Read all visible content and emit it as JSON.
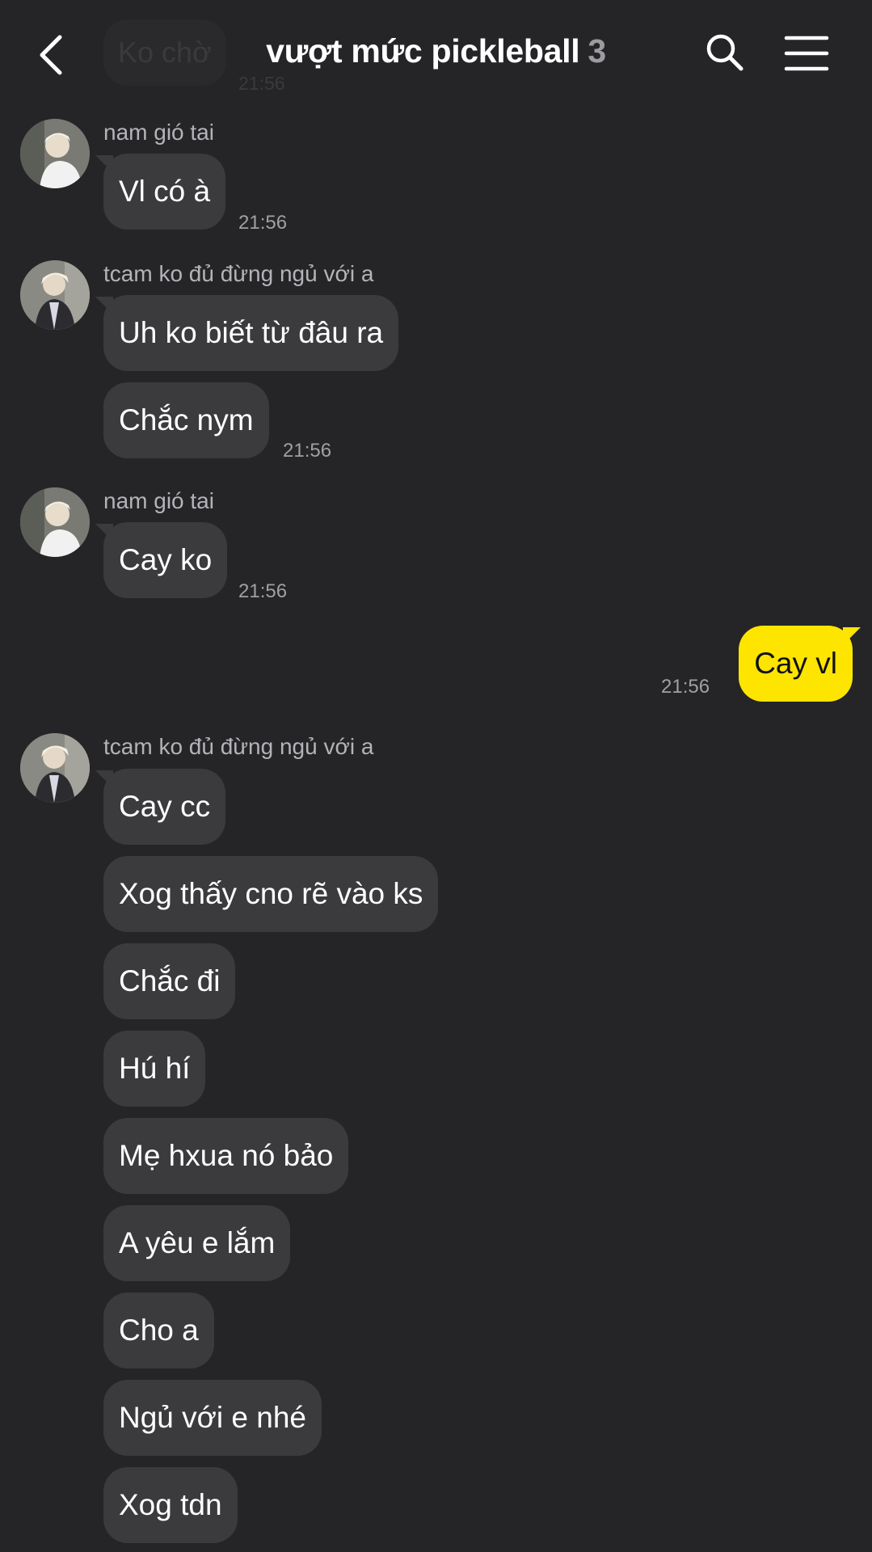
{
  "header": {
    "title": "vượt mức pickleball",
    "member_count": "3"
  },
  "ghost": {
    "message": "Ko chờ",
    "time": "21:56"
  },
  "messages": [
    {
      "sender": "nam gió tai",
      "text": "Vl có à",
      "time": "21:56"
    },
    {
      "sender": "tcam ko đủ đừng ngủ với a",
      "text": "Uh ko biết từ đâu ra"
    },
    {
      "text": "Chắc nym",
      "time": "21:56"
    },
    {
      "sender": "nam gió tai",
      "text": "Cay ko",
      "time": "21:56"
    },
    {
      "mine": true,
      "text": "Cay vl",
      "time": "21:56"
    },
    {
      "sender": "tcam ko đủ đừng ngủ với a",
      "text": "Cay cc"
    },
    {
      "text": "Xog thấy cno rẽ vào ks"
    },
    {
      "text": "Chắc đi"
    },
    {
      "text": "Hú hí"
    },
    {
      "text": "Mẹ hxua nó bảo"
    },
    {
      "text": "A yêu e lắm"
    },
    {
      "text": "Cho a"
    },
    {
      "text": "Ngủ với e nhé"
    },
    {
      "text": "Xog tdn"
    }
  ],
  "colors": {
    "background": "#252528",
    "incoming_bubble": "#3b3b3e",
    "outgoing_bubble": "#fee500"
  },
  "icons": [
    "back-arrow-icon",
    "search-icon",
    "menu-icon"
  ]
}
